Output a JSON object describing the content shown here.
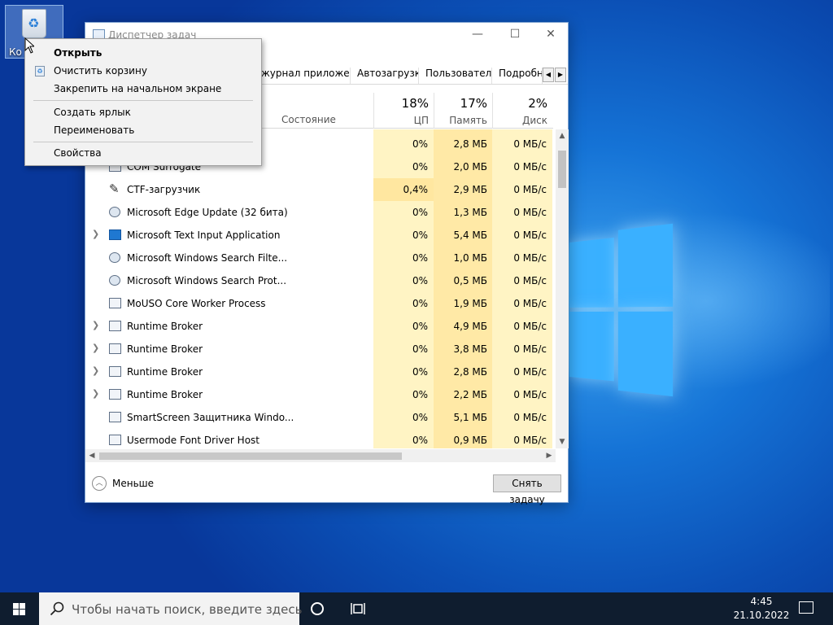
{
  "desktop": {
    "recycle_bin_label": "Ко"
  },
  "window": {
    "title": "Диспетчер задач",
    "tabs": [
      "журнал приложений",
      "Автозагрузка",
      "Пользователи",
      "Подробнос"
    ],
    "columns": {
      "state": "Состояние",
      "cpu": {
        "pct": "18%",
        "name": "ЦП"
      },
      "memory": {
        "pct": "17%",
        "name": "Память"
      },
      "disk": {
        "pct": "2%",
        "name": "Диск"
      }
    },
    "rows": [
      {
        "name": "",
        "cpu": "0%",
        "mem": "2,8 МБ",
        "disk": "0 МБ/с",
        "expandable": false,
        "icon": "app-icon"
      },
      {
        "name": "COM Surrogate",
        "cpu": "0%",
        "mem": "2,0 МБ",
        "disk": "0 МБ/с",
        "expandable": false,
        "icon": "app-icon"
      },
      {
        "name": "CTF-загрузчик",
        "cpu": "0,4%",
        "mem": "2,9 МБ",
        "disk": "0 МБ/с",
        "expandable": false,
        "icon": "pen-icon"
      },
      {
        "name": "Microsoft Edge Update (32 бита)",
        "cpu": "0%",
        "mem": "1,3 МБ",
        "disk": "0 МБ/с",
        "expandable": false,
        "icon": "user-icon"
      },
      {
        "name": "Microsoft Text Input Application",
        "cpu": "0%",
        "mem": "5,4 МБ",
        "disk": "0 МБ/с",
        "expandable": true,
        "icon": "blue-app-icon"
      },
      {
        "name": "Microsoft Windows Search Filte...",
        "cpu": "0%",
        "mem": "1,0 МБ",
        "disk": "0 МБ/с",
        "expandable": false,
        "icon": "user-icon"
      },
      {
        "name": "Microsoft Windows Search Prot...",
        "cpu": "0%",
        "mem": "0,5 МБ",
        "disk": "0 МБ/с",
        "expandable": false,
        "icon": "user-icon"
      },
      {
        "name": "MoUSO Core Worker Process",
        "cpu": "0%",
        "mem": "1,9 МБ",
        "disk": "0 МБ/с",
        "expandable": false,
        "icon": "app-icon"
      },
      {
        "name": "Runtime Broker",
        "cpu": "0%",
        "mem": "4,9 МБ",
        "disk": "0 МБ/с",
        "expandable": true,
        "icon": "app-icon"
      },
      {
        "name": "Runtime Broker",
        "cpu": "0%",
        "mem": "3,8 МБ",
        "disk": "0 МБ/с",
        "expandable": true,
        "icon": "app-icon"
      },
      {
        "name": "Runtime Broker",
        "cpu": "0%",
        "mem": "2,8 МБ",
        "disk": "0 МБ/с",
        "expandable": true,
        "icon": "app-icon"
      },
      {
        "name": "Runtime Broker",
        "cpu": "0%",
        "mem": "2,2 МБ",
        "disk": "0 МБ/с",
        "expandable": true,
        "icon": "app-icon"
      },
      {
        "name": "SmartScreen Защитника Windo...",
        "cpu": "0%",
        "mem": "5,1 МБ",
        "disk": "0 МБ/с",
        "expandable": false,
        "icon": "app-icon"
      },
      {
        "name": "Usermode Font Driver Host",
        "cpu": "0%",
        "mem": "0,9 МБ",
        "disk": "0 МБ/с",
        "expandable": false,
        "icon": "app-icon"
      }
    ],
    "fewer_label": "Меньше",
    "end_task_label": "Снять задачу"
  },
  "context_menu": {
    "items": [
      "Открыть",
      "Очистить корзину",
      "Закрепить на начальном экране",
      "Создать ярлык",
      "Переименовать",
      "Свойства"
    ]
  },
  "taskbar": {
    "search_placeholder": "Чтобы начать поиск, введите здесь",
    "time": "4:45",
    "date": "21.10.2022"
  }
}
